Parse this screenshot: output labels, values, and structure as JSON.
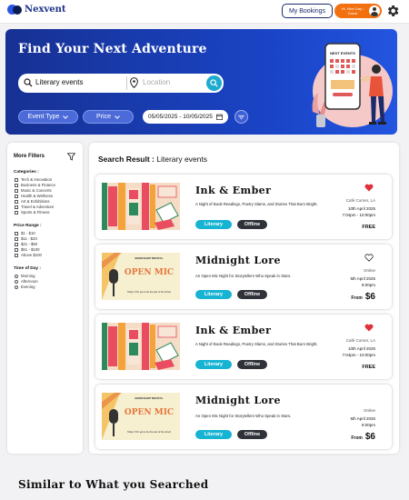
{
  "nav": {
    "brand": "Nexvent",
    "bookings_label": "My Bookings",
    "user_greeting": "Hi, Nice Day ! Guest"
  },
  "hero": {
    "title": "Find Your Next Adventure",
    "search_value": "Literary events",
    "location_placeholder": "Location",
    "event_type_label": "Event Type",
    "price_label": "Price",
    "date_range": "05/05/2025 - 10/05/2025",
    "illustration_sign": "NEXT EVENTS"
  },
  "filters": {
    "title": "More Filters",
    "categories_heading": "Categories :",
    "categories": [
      "Tech & Innovation",
      "Business & Finance",
      "Music & Concerts",
      "Health & Wellness",
      "Art & Exhibitions",
      "Travel & Adventure",
      "Sports & Fitness"
    ],
    "price_heading": "Price Range :",
    "prices": [
      "$1 - $10",
      "$11 - $20",
      "$21 - $50",
      "$51 - $100",
      "Above $100"
    ],
    "time_heading": "Time of Day :",
    "times": [
      "Morning",
      "Afternoon",
      "Evening"
    ]
  },
  "results": {
    "heading_prefix": "Search Result : ",
    "heading_query": "Literary events",
    "cards": [
      {
        "title": "Ink & Ember",
        "description": "A Night of Book Readings, Poetry Slams, and Stories That Burn Bright.",
        "tag1": "Literary",
        "tag2": "Offline",
        "venue": "Café Corner, LA",
        "date": "10th April 2025",
        "time": "7:04pm - 10:00pm",
        "price": "FREE",
        "favorited": true
      },
      {
        "title": "Midnight Lore",
        "description": "An Open Mic Night for Storytellers Who Speak in Stars.",
        "tag1": "Literary",
        "tag2": "Offline",
        "venue": "Online",
        "date": "5th April 2025",
        "time": "8:00pm",
        "price_prefix": "From",
        "price": "$6",
        "favorited": false,
        "poster_header": "BOOKSHOP RECITAL",
        "poster_text": "OPEN MIC",
        "poster_caption": "Today YOU get to be the star of the show!"
      },
      {
        "title": "Ink & Ember",
        "description": "A Night of Book Readings, Poetry Slams, and Stories That Burn Bright.",
        "tag1": "Literary",
        "tag2": "Offline",
        "venue": "Café Corner, LA",
        "date": "10th April 2025",
        "time": "7:04pm - 10:00pm",
        "price": "FREE",
        "favorited": true
      },
      {
        "title": "Midnight Lore",
        "description": "An Open Mic Night for Storytellers Who Speak in Stars.",
        "tag1": "Literary",
        "tag2": "Offline",
        "venue": "Online",
        "date": "5th April 2025",
        "time": "8:00pm",
        "price_prefix": "From",
        "price": "$6",
        "favorited": false,
        "poster_header": "BOOKSHOP RECITAL",
        "poster_text": "OPEN MIC",
        "poster_caption": "Today YOU get to be the star of the show!"
      }
    ]
  },
  "similar_heading": "Similar to What you Searched",
  "icons": [
    "search-icon",
    "location-pin-icon",
    "chevron-down-icon",
    "calendar-icon",
    "filter-icon",
    "heart-icon",
    "gear-icon",
    "avatar"
  ],
  "colors": {
    "brand_blue": "#1b2f86",
    "hero_blue": "#1a45c8",
    "accent_orange": "#f3700f",
    "tag_literary": "#17b3d3",
    "tag_offline": "#2f3239",
    "heart_red": "#e0303a"
  }
}
